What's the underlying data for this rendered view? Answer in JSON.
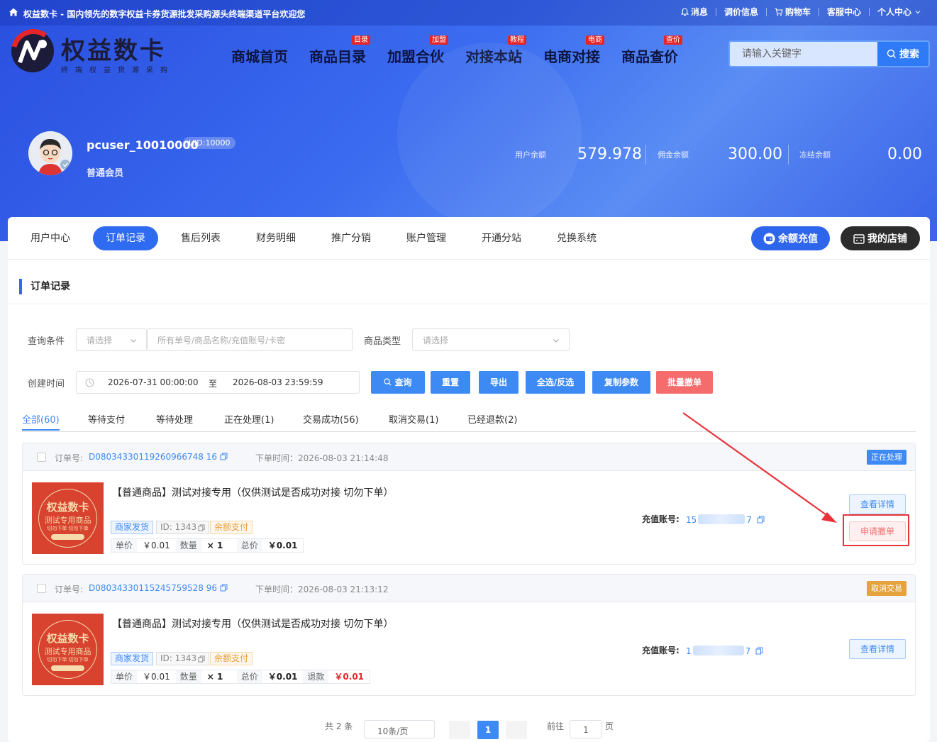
{
  "topbar": {
    "welcome": "权益数卡 - 国内领先的数字权益卡券货源批发采购源头终端渠道平台欢迎您",
    "links": [
      "消息",
      "调价信息",
      "购物车",
      "客服中心",
      "个人中心"
    ]
  },
  "logo": {
    "name": "权益数卡",
    "slogan": "终端权益货源采购"
  },
  "nav": [
    {
      "label": "商城首页",
      "badge": ""
    },
    {
      "label": "商品目录",
      "badge": "目录"
    },
    {
      "label": "加盟合伙",
      "badge": "加盟"
    },
    {
      "label": "对接本站",
      "badge": "教程"
    },
    {
      "label": "电商对接",
      "badge": "电商"
    },
    {
      "label": "商品查价",
      "badge": "查价"
    }
  ],
  "search": {
    "placeholder": "请输入关键字",
    "button": "搜索"
  },
  "user": {
    "name": "pcuser_10010000",
    "uid": "UID:10000",
    "level": "普通会员",
    "balance_label": "用户余额",
    "balance": "579.978",
    "commission_label": "佣金余额",
    "commission": "300.00",
    "frozen_label": "冻结余额",
    "frozen": "0.00"
  },
  "tabs": [
    "用户中心",
    "订单记录",
    "售后列表",
    "财务明细",
    "推广分销",
    "账户管理",
    "开通分站",
    "兑换系统"
  ],
  "actions": {
    "recharge": "余额充值",
    "shop": "我的店铺"
  },
  "section_title": "订单记录",
  "filters": {
    "query_label": "查询条件",
    "query_select": "请选择",
    "query_placeholder": "所有单号/商品名称/充值账号/卡密",
    "type_label": "商品类型",
    "type_select": "请选择",
    "time_label": "创建时间",
    "start": "2026-07-31 00:00:00",
    "to": "至",
    "end": "2026-08-03 23:59:59"
  },
  "buttons": [
    "查询",
    "重置",
    "导出",
    "全选/反选",
    "复制参数",
    "批量撤单"
  ],
  "status_tabs": [
    "全部(60)",
    "等待支付",
    "等待处理",
    "正在处理(1)",
    "交易成功(56)",
    "取消交易(1)",
    "已经退款(2)"
  ],
  "colors": {
    "primary": "#3e8af5",
    "processing": "#3e8af5",
    "cancelled": "#e6a23c",
    "danger": "#e4262b"
  },
  "thumb": {
    "line1": "权益数卡",
    "line2": "测试专用商品",
    "line3": "切勿下单 切勿下单"
  },
  "orders": [
    {
      "order_label": "订单号:",
      "order_no": "D08034330119260966748 16",
      "time": "下单时间：2026-08-03 21:14:48",
      "status": "正在处理",
      "title": "【普通商品】测试对接专用（仅供测试是否成功对接 切勿下单）",
      "tags": [
        "商家发货",
        "ID: 1343",
        "余额支付"
      ],
      "price_label": "单价",
      "price": "￥0.01",
      "qty_label": "数量",
      "qty": "× 1",
      "total_label": "总价",
      "total": "￥0.01",
      "account_label": "充值账号:",
      "account_start": "15",
      "account_end": "7",
      "btn_detail": "查看详情",
      "btn_cancel": "申请撤单"
    },
    {
      "order_label": "订单号:",
      "order_no": "D08034330115245759528 96",
      "time": "下单时间：2026-08-03 21:13:12",
      "status": "取消交易",
      "title": "【普通商品】测试对接专用（仅供测试是否成功对接 切勿下单）",
      "tags": [
        "商家发货",
        "ID: 1343",
        "余额支付"
      ],
      "price_label": "单价",
      "price": "￥0.01",
      "qty_label": "数量",
      "qty": "× 1",
      "total_label": "总价",
      "total": "￥0.01",
      "refund_label": "退款",
      "refund": "￥0.01",
      "account_label": "充值账号:",
      "account_start": "1",
      "account_end": "7",
      "btn_detail": "查看详情"
    }
  ],
  "pager": {
    "total": "共 2 条",
    "size": "10条/页",
    "page": "1",
    "goto": "前往",
    "goto_value": "1",
    "page_unit": "页"
  }
}
